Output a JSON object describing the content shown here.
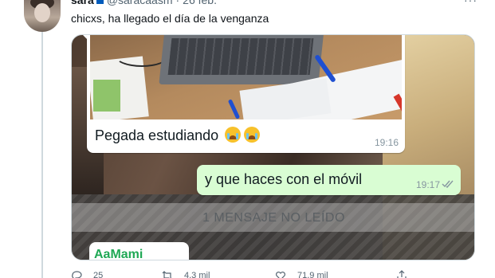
{
  "tweet": {
    "display_name": "sara",
    "handle": "@saracaasm",
    "separator": "·",
    "date": "26 feb.",
    "more_label": "···",
    "text": "chicxs, ha llegado el día de la venganza"
  },
  "chat": {
    "incoming_message": "Pegada estudiando",
    "incoming_time": "19:16",
    "outgoing_message": "y que haces con el móvil",
    "outgoing_time": "19:17",
    "unread_banner": "1 MENSAJE NO LEÍDO",
    "next_sender": "AaMami"
  },
  "actions": {
    "replies": "25",
    "retweets": "4,3 mil",
    "likes": "71,9 mil"
  },
  "colors": {
    "outgoing_bubble": "#d9fdd3",
    "sender_name": "#1fa855",
    "ticks": "#8696a0"
  }
}
